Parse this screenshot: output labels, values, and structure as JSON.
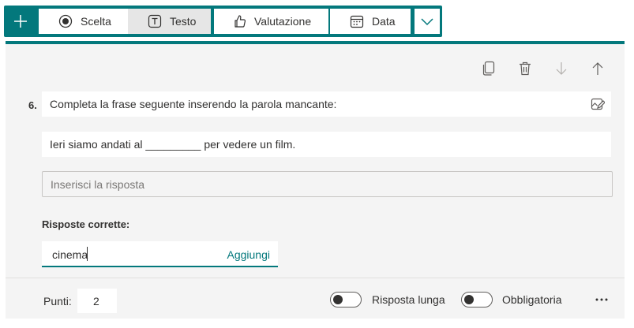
{
  "toolbar": {
    "add_icon": "plus-icon",
    "buttons": [
      {
        "label": "Scelta",
        "icon": "radio-choice-icon"
      },
      {
        "label": "Testo",
        "icon": "text-icon"
      },
      {
        "label": "Valutazione",
        "icon": "thumbs-up-icon"
      },
      {
        "label": "Data",
        "icon": "calendar-icon"
      }
    ],
    "selected": "Testo",
    "more_icon": "chevron-down-icon"
  },
  "card": {
    "actions": [
      "copy-icon",
      "trash-icon",
      "arrow-down-icon",
      "arrow-up-icon"
    ],
    "question_number": "6.",
    "question_title": "Completa la frase seguente inserendo la parola mancante:",
    "question_subtitle": "Ieri siamo andati al _________ per vedere un film.",
    "answer_placeholder": "Inserisci la risposta",
    "correct_answers_label": "Risposte corrette:",
    "correct_answer_value": "cinema",
    "add_label": "Aggiungi"
  },
  "footer": {
    "points_label": "Punti:",
    "points_value": "2",
    "toggles": [
      {
        "label": "Risposta lunga",
        "on": false
      },
      {
        "label": "Obbligatoria",
        "on": false
      }
    ],
    "more_icon": "more-icon"
  },
  "colors": {
    "accent": "#03787c",
    "card_background": "#f4f4f4",
    "selected_button": "#e6e6e6"
  }
}
